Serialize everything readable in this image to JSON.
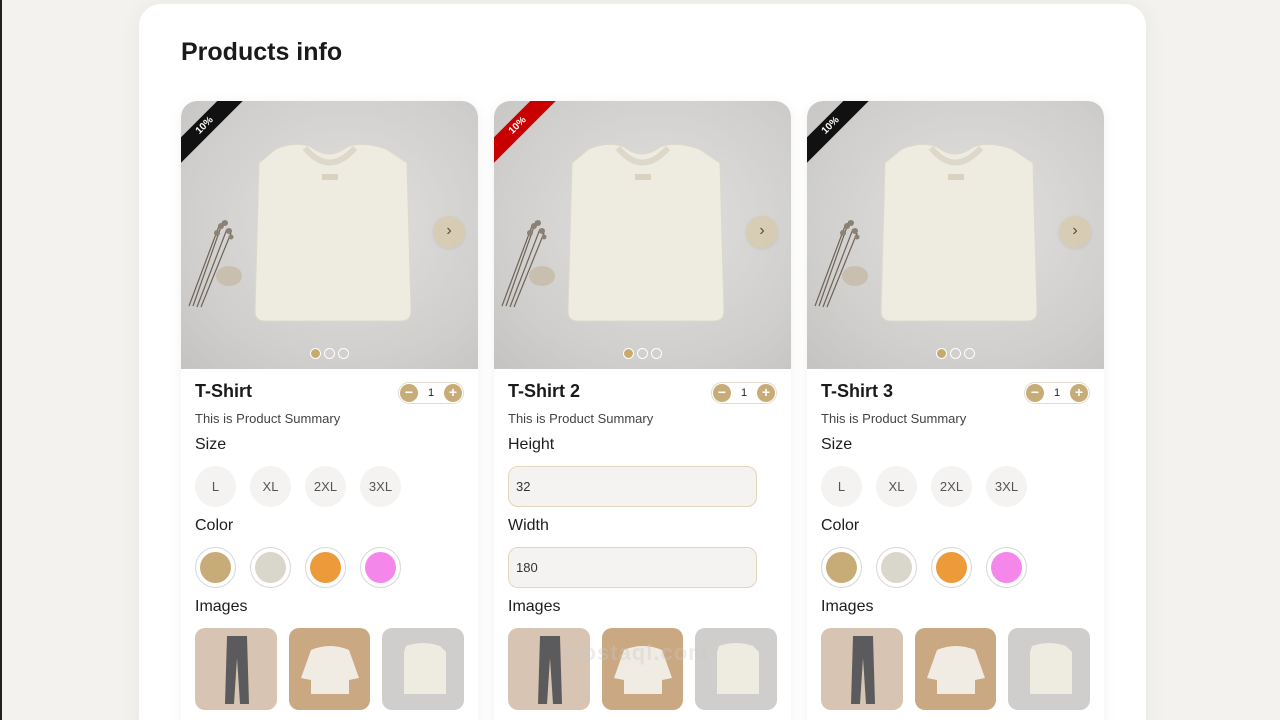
{
  "page": {
    "title": "Products info"
  },
  "cards": [
    {
      "badge": "10%",
      "badge_color": "#111111",
      "name": "T-Shirt",
      "quantity": "1",
      "summary": "This is Product Summary",
      "size_label": "Size",
      "sizes": [
        "L",
        "XL",
        "2XL",
        "3XL"
      ],
      "color_label": "Color",
      "colors": [
        "#c8ac78",
        "#d9d6cc",
        "#ec9a3a",
        "#f587ea"
      ],
      "images_label": "Images",
      "slide_count": 3,
      "active_slide": 1
    },
    {
      "badge": "10%",
      "badge_color": "#c80000",
      "name": "T-Shirt 2",
      "quantity": "1",
      "summary": "This is Product Summary",
      "height_label": "Height",
      "height_value": "32",
      "width_label": "Width",
      "width_value": "180",
      "images_label": "Images",
      "slide_count": 3,
      "active_slide": 1
    },
    {
      "badge": "10%",
      "badge_color": "#111111",
      "name": "T-Shirt 3",
      "quantity": "1",
      "summary": "This is Product Summary",
      "size_label": "Size",
      "sizes": [
        "L",
        "XL",
        "2XL",
        "3XL"
      ],
      "color_label": "Color",
      "colors": [
        "#c8ac78",
        "#d9d6cc",
        "#ec9a3a",
        "#f587ea"
      ],
      "images_label": "Images",
      "slide_count": 3,
      "active_slide": 1
    }
  ],
  "icons": {
    "next": "chevron-right-icon",
    "minus": "minus-icon",
    "plus": "plus-icon"
  },
  "watermark": "mostaql.com"
}
